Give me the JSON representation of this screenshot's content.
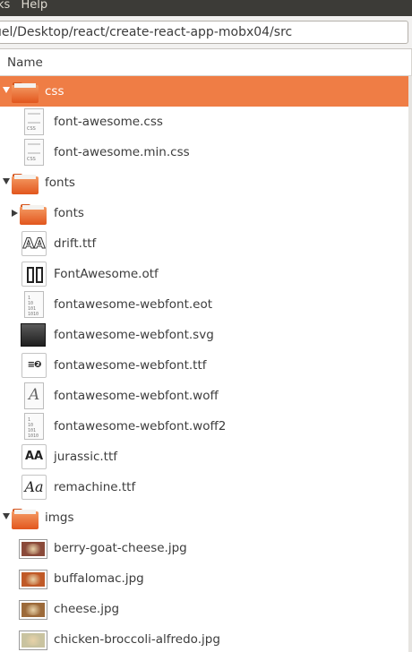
{
  "menubar": {
    "items": [
      "ks",
      "Help"
    ]
  },
  "path": {
    "value": "uel/Desktop/react/create-react-app-mobx04/src"
  },
  "columns": {
    "name": "Name"
  },
  "tree": [
    {
      "label": "css",
      "type": "folder",
      "level": 0,
      "expanded": true,
      "selected": true
    },
    {
      "label": "font-awesome.css",
      "type": "css-file",
      "level": 1
    },
    {
      "label": "font-awesome.min.css",
      "type": "css-file",
      "level": 1
    },
    {
      "label": "fonts",
      "type": "folder",
      "level": 0,
      "expanded": true
    },
    {
      "label": "fonts",
      "type": "folder",
      "level": 1,
      "expanded": false
    },
    {
      "label": "drift.ttf",
      "type": "font-outline",
      "level": 1,
      "glyph": "AA"
    },
    {
      "label": "FontAwesome.otf",
      "type": "font-bars",
      "level": 1
    },
    {
      "label": "fontawesome-webfont.eot",
      "type": "binary-file",
      "level": 1,
      "bin": "1\n10\n101\n1010"
    },
    {
      "label": "fontawesome-webfont.svg",
      "type": "svg-file",
      "level": 1
    },
    {
      "label": "fontawesome-webfont.ttf",
      "type": "font-glyph",
      "level": 1,
      "glyph": "≡❷"
    },
    {
      "label": "fontawesome-webfont.woff",
      "type": "serif-file",
      "level": 1,
      "glyph": "A"
    },
    {
      "label": "fontawesome-webfont.woff2",
      "type": "binary-file",
      "level": 1,
      "bin": "1\n10\n101\n1010"
    },
    {
      "label": "jurassic.ttf",
      "type": "font-bold",
      "level": 1,
      "glyph": "AA"
    },
    {
      "label": "remachine.ttf",
      "type": "font-serif",
      "level": 1,
      "glyph": "Aa"
    },
    {
      "label": "imgs",
      "type": "folder",
      "level": 0,
      "expanded": true
    },
    {
      "label": "berry-goat-cheese.jpg",
      "type": "image",
      "level": 1,
      "tint": "#8a4a3a"
    },
    {
      "label": "buffalomac.jpg",
      "type": "image",
      "level": 1,
      "tint": "#c05a28"
    },
    {
      "label": "cheese.jpg",
      "type": "image",
      "level": 1,
      "tint": "#9c6a3a"
    },
    {
      "label": "chicken-broccoli-alfredo.jpg",
      "type": "image",
      "level": 1,
      "tint": "#c9c3a0"
    }
  ],
  "colors": {
    "selection": "#ef7d45",
    "folder": "#e2561d",
    "menubar": "#3c3b37"
  }
}
